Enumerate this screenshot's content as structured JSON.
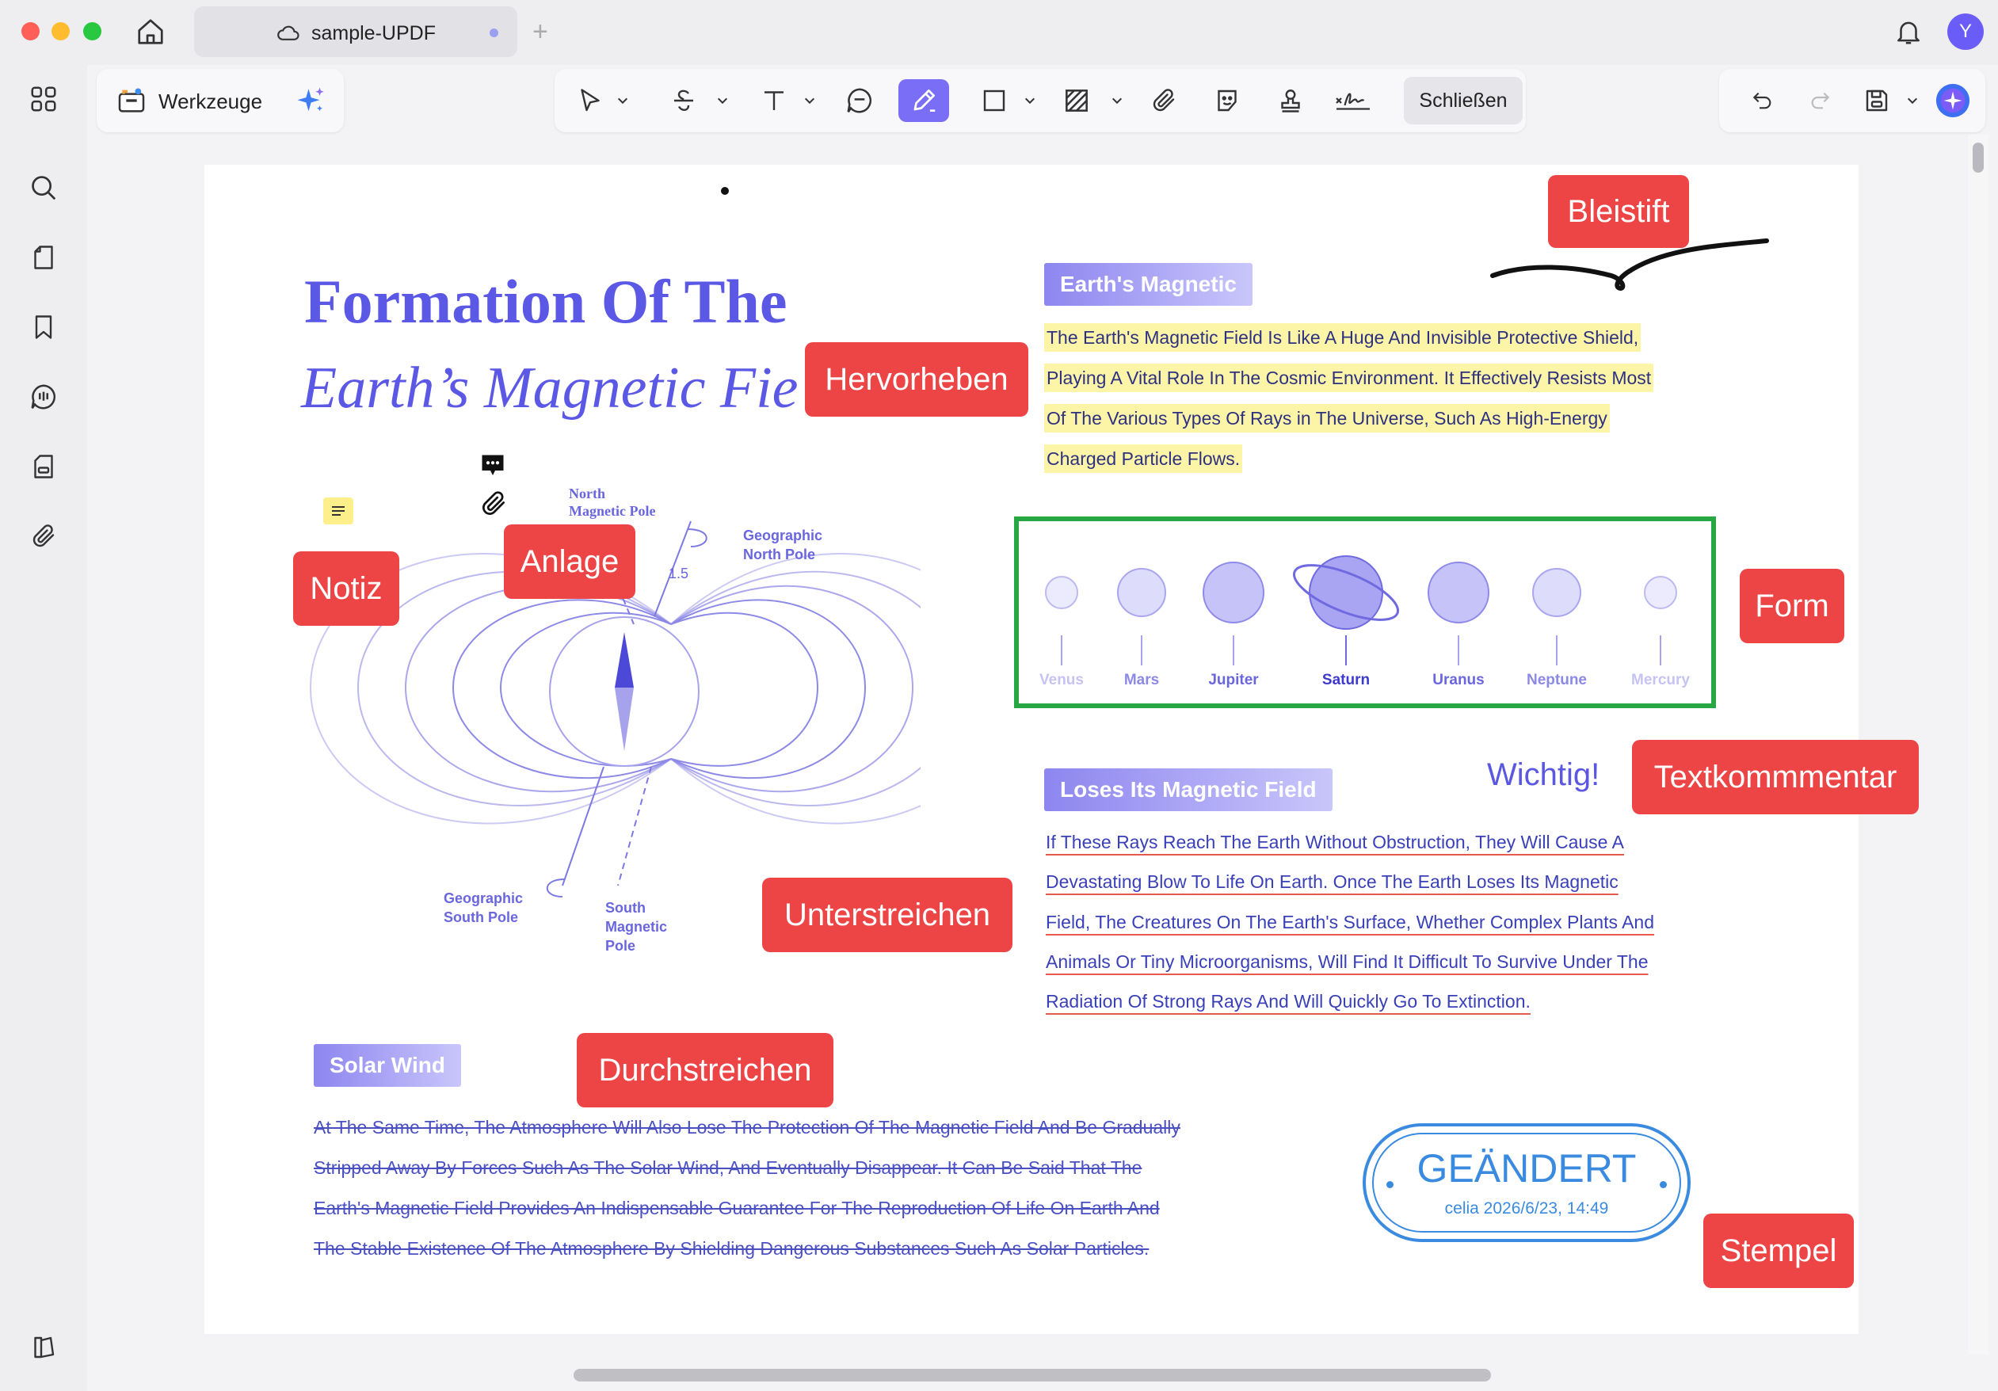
{
  "window": {
    "tab_title": "sample-UPDF",
    "new_tab_symbol": "+",
    "avatar_initial": "Y"
  },
  "toolbar": {
    "tools_label": "Werkzeuge",
    "close_label": "Schließen",
    "tools": [
      "select-tool",
      "strikethrough-tool",
      "text-tool",
      "comment-tool",
      "pencil-tool",
      "rectangle-tool",
      "area-highlight-tool",
      "attachment-tool",
      "sticker-tool",
      "stamp-tool",
      "signature-tool"
    ],
    "active_tool": "pencil-tool"
  },
  "sidebar": {
    "items": [
      "thumbnails-icon",
      "search-icon",
      "pages-icon",
      "bookmark-icon",
      "comments-icon",
      "form-icon",
      "attachment-icon",
      "layers-icon"
    ]
  },
  "document": {
    "title_line1": "Formation Of The",
    "title_line2": "Earth’s Magnetic Fie",
    "section_magnetic": {
      "heading": "Earth's Magnetic",
      "lines": [
        "The Earth's Magnetic Field Is Like A Huge And Invisible Protective Shield,",
        "Playing A Vital Role In The Cosmic Environment. It Effectively Resists Most",
        "Of The Various Types Of Rays in The Universe, Such As High-Energy",
        "Charged Particle Flows."
      ]
    },
    "planets": [
      {
        "name": "Venus",
        "color": "#c9c7f3"
      },
      {
        "name": "Mars",
        "color": "#9d99ec"
      },
      {
        "name": "Jupiter",
        "color": "#7672e6"
      },
      {
        "name": "Saturn",
        "color": "#4b47d8"
      },
      {
        "name": "Uranus",
        "color": "#7672e6"
      },
      {
        "name": "Neptune",
        "color": "#9d99ec"
      },
      {
        "name": "Mercury",
        "color": "#c9c7f3"
      }
    ],
    "section_loses": {
      "heading": "Loses Its Magnetic Field",
      "lines": [
        "If These Rays Reach The Earth Without Obstruction, They Will Cause A",
        "Devastating Blow To Life On Earth. Once The Earth Loses Its Magnetic",
        "Field, The Creatures On The Earth's Surface, Whether Complex Plants And",
        "Animals Or Tiny Microorganisms, Will Find It Difficult To Survive Under The",
        "Radiation Of Strong Rays And Will Quickly Go To Extinction."
      ]
    },
    "section_solar": {
      "heading": "Solar Wind",
      "lines": [
        "At The Same Time, The Atmosphere Will Also Lose The Protection Of The Magnetic Field And Be Gradually",
        "Stripped Away By Forces Such As The Solar Wind, And Eventually Disappear. It Can Be Said That The",
        "Earth's Magnetic Field Provides An Indispensable Guarantee For The Reproduction Of Life On Earth And",
        "The Stable Existence Of The Atmosphere By Shielding Dangerous Substances Such As Solar Particles."
      ]
    },
    "diagram_labels": {
      "north_magnetic": [
        "North",
        "Magnetic Pole"
      ],
      "geographic_north": [
        "Geographic",
        "North Pole"
      ],
      "angle": "1.5",
      "geographic_south": [
        "Geographic",
        "South Pole"
      ],
      "south_magnetic": [
        "South",
        "Magnetic",
        "Pole"
      ]
    },
    "text_comment": "Wichtig!",
    "stamp": {
      "title": "GEÄNDERT",
      "subtitle": "celia 2026/6/23, 14:49"
    }
  },
  "callouts": {
    "pencil": "Bleistift",
    "highlight": "Hervorheben",
    "note": "Notiz",
    "attachment": "Anlage",
    "shape": "Form",
    "text_comment": "Textkommmentar",
    "underline": "Unterstreichen",
    "strikethrough": "Durchstreichen",
    "stamp": "Stempel"
  },
  "colors": {
    "accent": "#7b6ef6",
    "callout": "#ed4546",
    "highlight": "#fcf5a8",
    "shape_border": "#27a844",
    "stamp": "#3a8be0",
    "title": "#5b58e6"
  }
}
